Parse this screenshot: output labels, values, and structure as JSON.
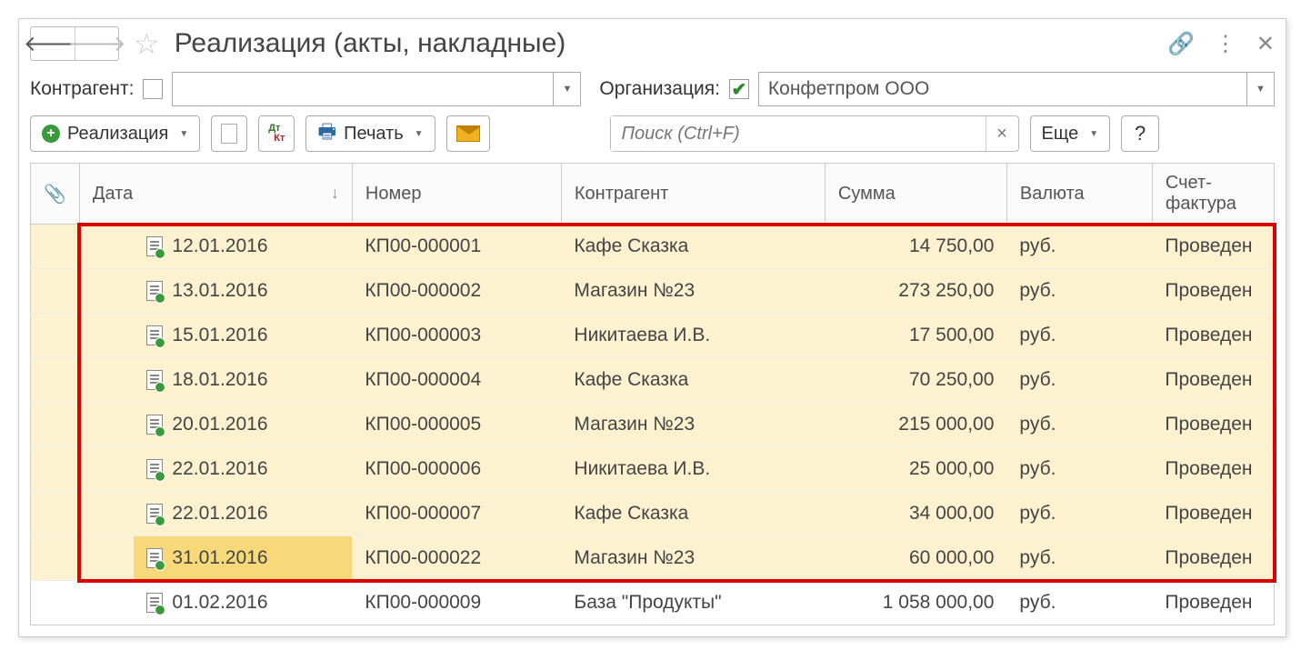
{
  "title": "Реализация (акты, накладные)",
  "filters": {
    "counterparty_label": "Контрагент:",
    "counterparty_checked": false,
    "counterparty_value": "",
    "org_label": "Организация:",
    "org_checked": true,
    "org_value": "Конфетпром ООО"
  },
  "toolbar": {
    "create_label": "Реализация",
    "print_label": "Печать",
    "more_label": "Еще",
    "search_placeholder": "Поиск (Ctrl+F)",
    "help_label": "?"
  },
  "columns": {
    "date": "Дата",
    "number": "Номер",
    "counterparty": "Контрагент",
    "sum": "Сумма",
    "currency": "Валюта",
    "invoice": "Счет-фактура"
  },
  "rows": [
    {
      "hi": true,
      "date": "12.01.2016",
      "number": "КП00-000001",
      "cp": "Кафе Сказка",
      "sum": "14 750,00",
      "cur": "руб.",
      "inv": "Проведен"
    },
    {
      "hi": true,
      "date": "13.01.2016",
      "number": "КП00-000002",
      "cp": "Магазин №23",
      "sum": "273 250,00",
      "cur": "руб.",
      "inv": "Проведен"
    },
    {
      "hi": true,
      "date": "15.01.2016",
      "number": "КП00-000003",
      "cp": "Никитаева И.В.",
      "sum": "17 500,00",
      "cur": "руб.",
      "inv": "Проведен"
    },
    {
      "hi": true,
      "date": "18.01.2016",
      "number": "КП00-000004",
      "cp": "Кафе Сказка",
      "sum": "70 250,00",
      "cur": "руб.",
      "inv": "Проведен"
    },
    {
      "hi": true,
      "date": "20.01.2016",
      "number": "КП00-000005",
      "cp": "Магазин №23",
      "sum": "215 000,00",
      "cur": "руб.",
      "inv": "Проведен"
    },
    {
      "hi": true,
      "date": "22.01.2016",
      "number": "КП00-000006",
      "cp": "Никитаева И.В.",
      "sum": "25 000,00",
      "cur": "руб.",
      "inv": "Проведен"
    },
    {
      "hi": true,
      "date": "22.01.2016",
      "number": "КП00-000007",
      "cp": "Кафе Сказка",
      "sum": "34 000,00",
      "cur": "руб.",
      "inv": "Проведен"
    },
    {
      "hi": true,
      "sel": true,
      "date": "31.01.2016",
      "number": "КП00-000022",
      "cp": "Магазин №23",
      "sum": "60 000,00",
      "cur": "руб.",
      "inv": "Проведен"
    },
    {
      "hi": false,
      "date": "01.02.2016",
      "number": "КП00-000009",
      "cp": "База \"Продукты\"",
      "sum": "1 058 000,00",
      "cur": "руб.",
      "inv": "Проведен"
    }
  ]
}
